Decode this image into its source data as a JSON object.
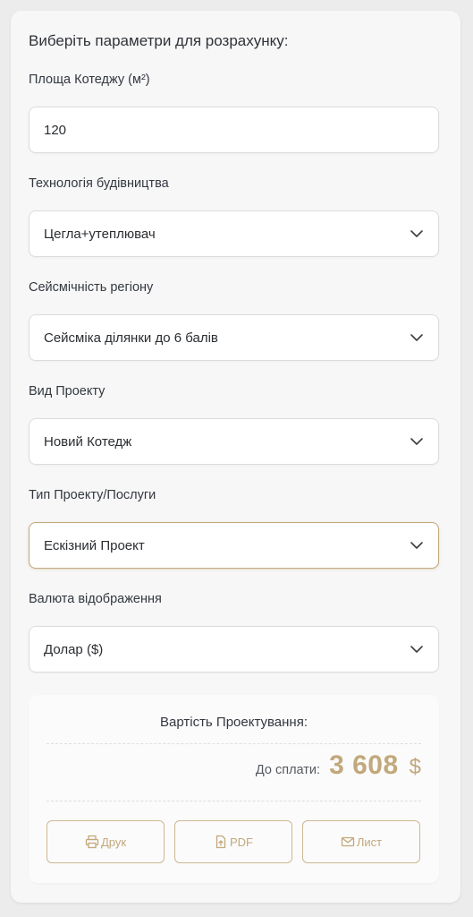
{
  "form": {
    "heading": "Виберіть параметри для розрахунку:",
    "area": {
      "label": "Площа Котеджу (м²)",
      "value": "120"
    },
    "technology": {
      "label": "Технологія будівництва",
      "value": "Цегла+утеплювач"
    },
    "seismic": {
      "label": "Сейсмічність регіону",
      "value": "Сейсміка ділянки до 6 балів"
    },
    "project_kind": {
      "label": "Вид Проекту",
      "value": "Новий Котедж"
    },
    "project_type": {
      "label": "Тип Проекту/Послуги",
      "value": "Ескізний Проект"
    },
    "currency": {
      "label": "Валюта відображення",
      "value": "Долар ($)"
    }
  },
  "result": {
    "title": "Вартість Проектування:",
    "pay_label": "До сплати:",
    "amount": "3 608",
    "currency_symbol": "$"
  },
  "actions": {
    "print_label": "Друк",
    "pdf_label": "PDF",
    "mail_label": "Лист"
  },
  "colors": {
    "accent": "#c2a87c",
    "background": "#ececec",
    "card": "#f7f7f7"
  },
  "icons": {
    "select_arrow": "chevron-down-icon",
    "print": "printer-icon",
    "pdf": "file-upload-icon",
    "mail": "envelope-icon"
  }
}
